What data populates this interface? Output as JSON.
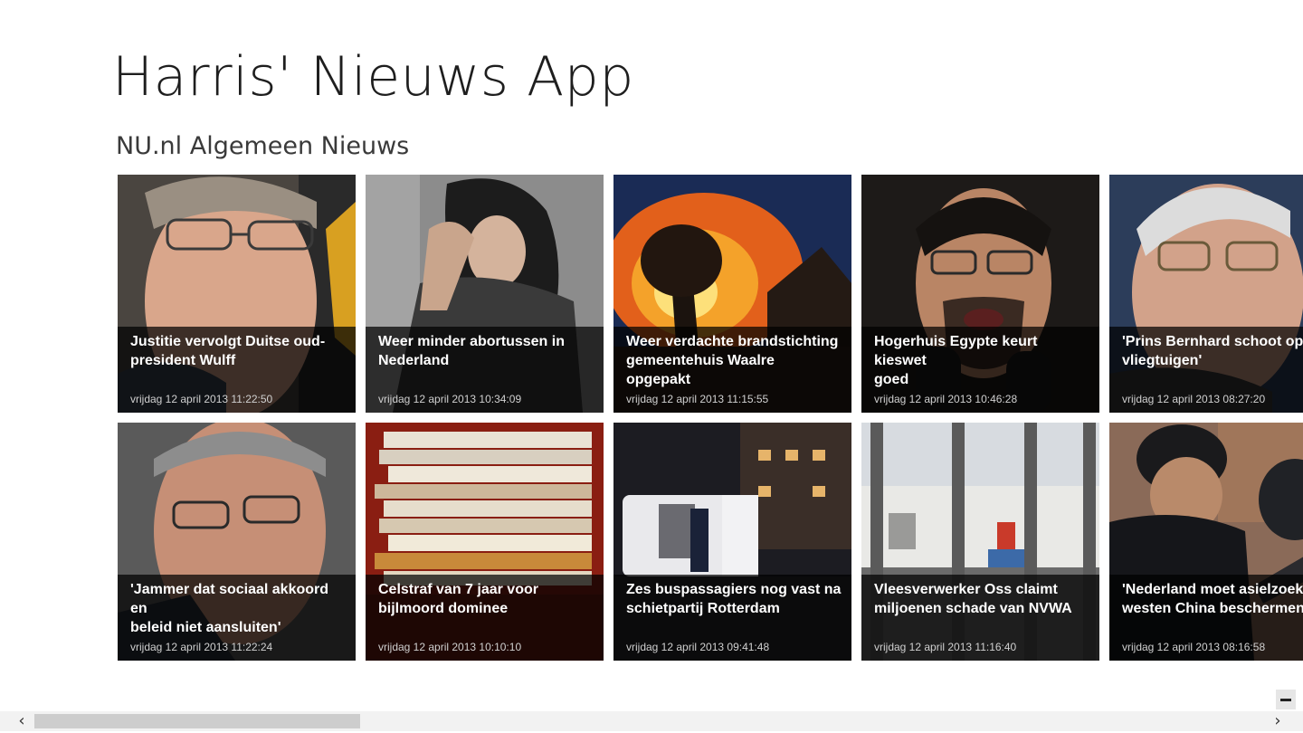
{
  "app": {
    "title": "Harris' Nieuws App"
  },
  "group": {
    "title": "NU.nl Algemeen Nieuws"
  },
  "tiles": [
    {
      "headline": "Justitie vervolgt Duitse oud-\npresident Wulff",
      "date": "vrijdag 12 april 2013 11:22:50"
    },
    {
      "headline": "Weer minder abortussen in\nNederland",
      "date": "vrijdag 12 april 2013 10:34:09"
    },
    {
      "headline": "Weer verdachte brandstichting\ngemeentehuis Waalre opgepakt",
      "date": "vrijdag 12 april 2013 11:15:55"
    },
    {
      "headline": "Hogerhuis Egypte keurt kieswet\ngoed",
      "date": "vrijdag 12 april 2013 10:46:28"
    },
    {
      "headline": "'Prins Bernhard schoot op D\nvliegtuigen'",
      "date": "vrijdag 12 april 2013 08:27:20"
    },
    {
      "headline": "'Jammer dat sociaal akkoord en\nbeleid niet aansluiten'",
      "date": "vrijdag 12 april 2013 11:22:24"
    },
    {
      "headline": "Celstraf van 7 jaar voor\nbijlmoord dominee",
      "date": "vrijdag 12 april 2013 10:10:10"
    },
    {
      "headline": "Zes buspassagiers nog vast na\nschietpartij Rotterdam",
      "date": "vrijdag 12 april 2013 09:41:48"
    },
    {
      "headline": "Vleesverwerker Oss claimt\nmiljoenen schade van NVWA",
      "date": "vrijdag 12 april 2013 11:16:40"
    },
    {
      "headline": "'Nederland moet asielzoeke\nwesten China beschermen'",
      "date": "vrijdag 12 april 2013 08:16:58"
    }
  ],
  "scrollbar": {
    "left_icon": "chevron-left-icon",
    "right_icon": "chevron-right-icon",
    "left_glyph": "‹",
    "right_glyph": "›"
  },
  "zoom": {
    "icon": "zoom-out-icon"
  }
}
